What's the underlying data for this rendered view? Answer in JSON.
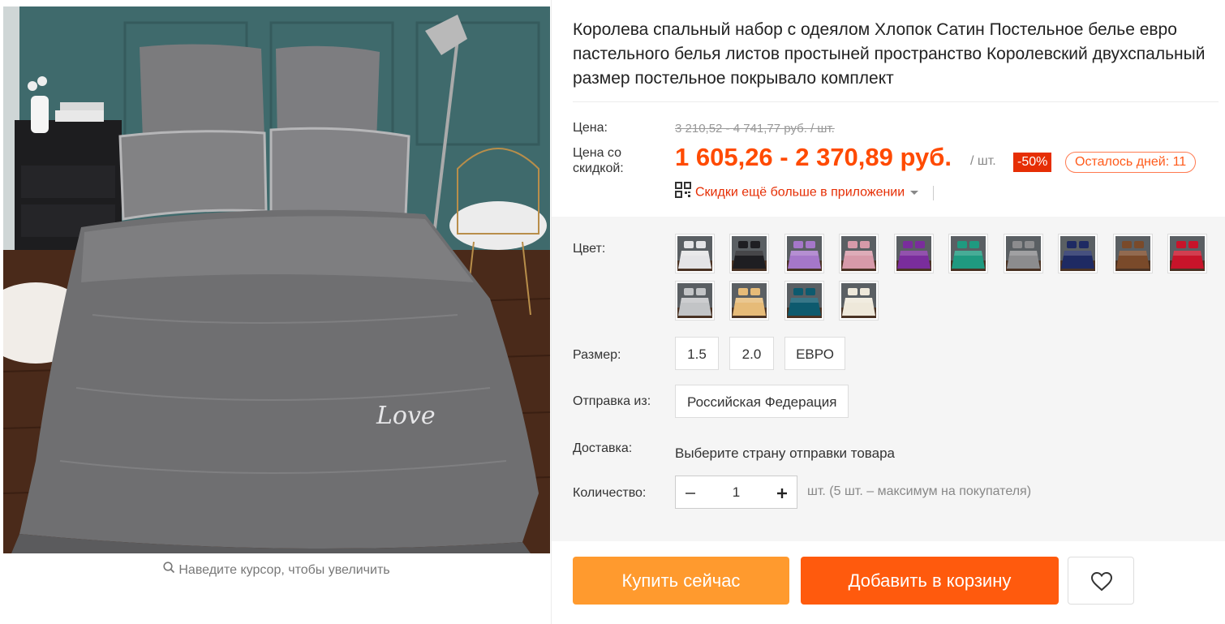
{
  "product": {
    "title": "Королева спальный набор с одеялом Хлопок Сатин Постельное белье евро пастельного белья листов простыней пространство Королевский двухспальный размер постельное покрывало комплект",
    "image_text": "Love",
    "zoom_hint": "Наведите курсор, чтобы увеличить"
  },
  "price": {
    "label": "Цена:",
    "original": "3 210,52 - 4 741,77 руб. / шт.",
    "discount_label": "Цена со скидкой:",
    "discounted": "1 605,26 - 2 370,89 руб.",
    "per_unit": "/ шт.",
    "discount_badge": "-50%",
    "days_left": "Осталось дней: 11",
    "app_promo": "Скидки ещё больше в приложении"
  },
  "sku": {
    "color_label": "Цвет:",
    "colors": [
      {
        "name": "white",
        "hex": "#e4e4e6"
      },
      {
        "name": "black",
        "hex": "#1e1e22"
      },
      {
        "name": "lavender",
        "hex": "#a577c9"
      },
      {
        "name": "pink",
        "hex": "#d79aa9"
      },
      {
        "name": "purple",
        "hex": "#7a2d9c"
      },
      {
        "name": "green",
        "hex": "#1f9a80"
      },
      {
        "name": "gray",
        "hex": "#8c8c8e"
      },
      {
        "name": "navy",
        "hex": "#1e2a63"
      },
      {
        "name": "brown",
        "hex": "#7a4a2a"
      },
      {
        "name": "red",
        "hex": "#c8142a"
      },
      {
        "name": "silver",
        "hex": "#c2c4c6"
      },
      {
        "name": "gold",
        "hex": "#e6bb78"
      },
      {
        "name": "teal",
        "hex": "#0d5a6e"
      },
      {
        "name": "ivory",
        "hex": "#eee8da"
      }
    ],
    "size_label": "Размер:",
    "sizes": [
      "1.5",
      "2.0",
      "ЕВРО"
    ],
    "ship_label": "Отправка из:",
    "ship_from": "Российская Федерация",
    "delivery_label": "Доставка:",
    "delivery_text": "Выберите страну отправки товара",
    "quantity_label": "Количество:",
    "quantity": "1",
    "quantity_note": "шт. (5 шт. – максимум на покупателя)"
  },
  "actions": {
    "buy_now": "Купить сейчас",
    "add_to_cart": "Добавить в корзину"
  },
  "colors": {
    "accent": "#ff5a0d",
    "buy_now_bg": "#ff9a2e",
    "price": "#ff4a00",
    "badge": "#e62e04"
  },
  "icons": [
    "search-icon",
    "qr-code-icon",
    "caret-down-icon",
    "minus-icon",
    "plus-icon",
    "heart-icon"
  ]
}
